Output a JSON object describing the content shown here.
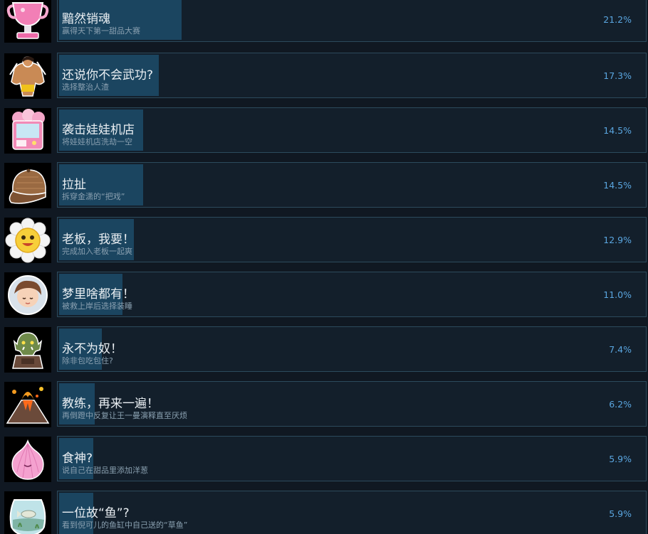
{
  "achievements": [
    {
      "title": "黯然销魂",
      "desc": "赢得天下第一甜品大赛",
      "percent_label": "21.2%",
      "percent": 21.2,
      "icon": "trophy-cup-icon"
    },
    {
      "title": "还说你不会武功?",
      "desc": "选择整治人渣",
      "percent_label": "17.3%",
      "percent": 17.3,
      "icon": "muscle-man-icon"
    },
    {
      "title": "袭击娃娃机店",
      "desc": "将娃娃机店洗劫一空",
      "percent_label": "14.5%",
      "percent": 14.5,
      "icon": "claw-machine-icon"
    },
    {
      "title": "拉扯",
      "desc": "拆穿金潇的“把戏”",
      "percent_label": "14.5%",
      "percent": 14.5,
      "icon": "cap-icon"
    },
    {
      "title": "老板，我要！",
      "desc": "完成加入老板一起爽",
      "percent_label": "12.9%",
      "percent": 12.9,
      "icon": "smiling-flower-icon"
    },
    {
      "title": "梦里啥都有！",
      "desc": "被救上岸后选择装睡",
      "percent_label": "11.0%",
      "percent": 11.0,
      "icon": "sleeping-girl-icon"
    },
    {
      "title": "永不为奴！",
      "desc": "除非包吃包住?",
      "percent_label": "7.4%",
      "percent": 7.4,
      "icon": "orc-warrior-icon"
    },
    {
      "title": "教练，再来一遍！",
      "desc": "再倒蹬中反复让王一曼演释直至厌烦",
      "percent_label": "6.2%",
      "percent": 6.2,
      "icon": "volcano-icon"
    },
    {
      "title": "食神?",
      "desc": "说自己在甜品里添加洋葱",
      "percent_label": "5.9%",
      "percent": 5.9,
      "icon": "pink-onion-icon"
    },
    {
      "title": "一位故“鱼”?",
      "desc": "看到倪可儿的鱼缸中自己送的“草鱼”",
      "percent_label": "5.9%",
      "percent": 5.9,
      "icon": "fish-tank-icon"
    }
  ],
  "colors": {
    "background": "#101822",
    "card": "#131f2b",
    "card_border": "#2c4a5c",
    "bar": "#1b4560",
    "title": "#e9eef2",
    "desc": "#8aa0b0",
    "percent": "#5aa6e0"
  }
}
